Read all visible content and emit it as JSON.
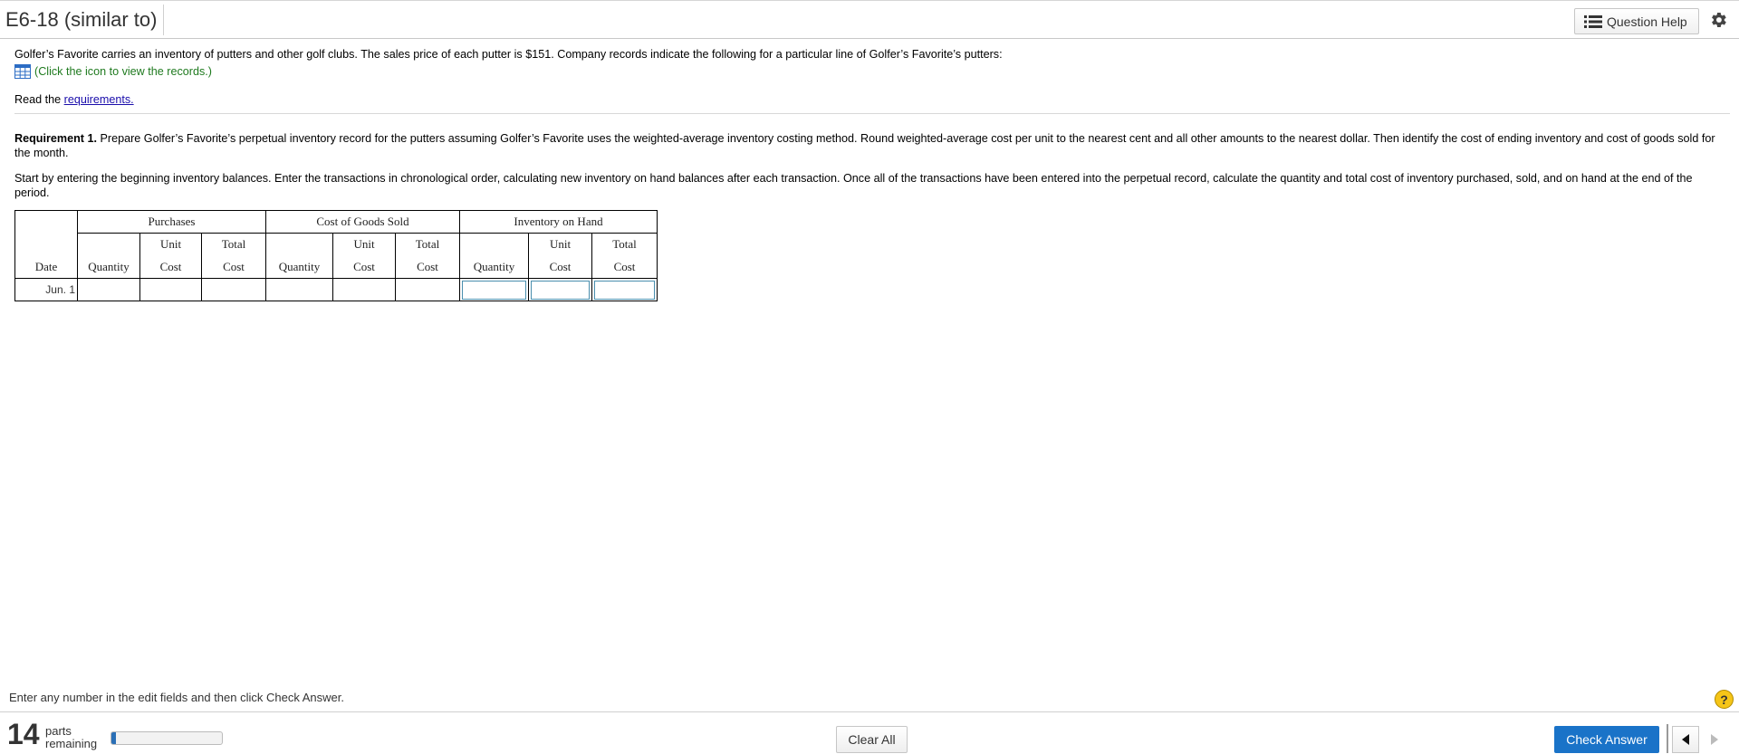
{
  "header": {
    "title": "E6-18 (similar to)",
    "question_help_label": "Question Help"
  },
  "content": {
    "intro": "Golfer’s Favorite carries an inventory of putters and other golf clubs. The sales price of each putter is $151. Company records indicate the following for a particular line of Golfer’s Favorite’s putters:",
    "records_link": "(Click the icon to view the records.)",
    "read_prefix": "Read the ",
    "requirements_link": "requirements.",
    "req_label": "Requirement 1.",
    "req_text": " Prepare Golfer’s Favorite’s perpetual inventory record for the putters assuming Golfer’s Favorite uses the weighted-average inventory costing method. Round weighted-average cost per unit to the nearest cent and all other amounts to the nearest dollar. Then identify the cost of ending inventory and cost of goods sold for the month.",
    "start_text": "Start by entering the beginning inventory balances. Enter the transactions in chronological order, calculating new inventory on hand balances after each transaction. Once all of the transactions have been entered into the perpetual record, calculate the quantity and total cost of inventory purchased, sold, and on hand at the end of the period."
  },
  "table": {
    "groups": [
      "Purchases",
      "Cost of Goods Sold",
      "Inventory on Hand"
    ],
    "row2": [
      "Unit",
      "Total",
      "Unit",
      "Total",
      "Unit",
      "Total"
    ],
    "row3": [
      "Date",
      "Quantity",
      "Cost",
      "Cost",
      "Quantity",
      "Cost",
      "Cost",
      "Quantity",
      "Cost",
      "Cost"
    ],
    "rows": [
      {
        "date": "Jun. 1"
      }
    ]
  },
  "footer": {
    "instruction": "Enter any number in the edit fields and then click Check Answer.",
    "help_glyph": "?",
    "parts_count": "14",
    "parts_label_1": "parts",
    "parts_label_2": "remaining",
    "progress_fraction": 0.04,
    "clear_all_label": "Clear All",
    "check_answer_label": "Check Answer"
  },
  "colors": {
    "accent": "#1a73c8",
    "link": "#1a0dab",
    "records_text": "#1f7a1f",
    "help_icon": "#f5c518"
  },
  "icons": [
    "list-icon",
    "gear-icon",
    "table-grid-icon",
    "help-icon",
    "prev-arrow-icon",
    "next-arrow-icon"
  ]
}
